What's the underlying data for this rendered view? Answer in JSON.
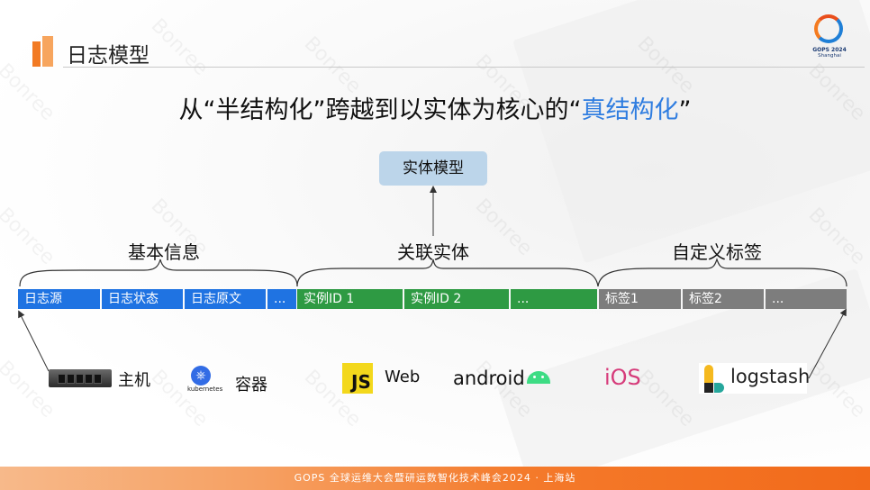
{
  "page_title": "日志模型",
  "logo": {
    "name": "GOPS 2024",
    "city": "Shanghai"
  },
  "headline": {
    "prefix": "从“半结构化”跨越到以实体为核心的“",
    "highlight": "真结构化",
    "suffix": "”"
  },
  "model_box": "实体模型",
  "groups": [
    {
      "label": "基本信息"
    },
    {
      "label": "关联实体"
    },
    {
      "label": "自定义标签"
    }
  ],
  "fields": {
    "basic": [
      "日志源",
      "日志状态",
      "日志原文",
      "..."
    ],
    "entity": [
      "实例ID 1",
      "实例ID 2",
      "..."
    ],
    "tags": [
      "标签1",
      "标签2",
      "..."
    ]
  },
  "sources": {
    "host": "主机",
    "container": "容器",
    "kubernetes": "kubernetes",
    "js_logo": "JS",
    "web": "Web",
    "android": "android",
    "ios": "iOS",
    "logstash": "logstash"
  },
  "colors": {
    "basic": "#1f73e2",
    "entity": "#2e9a43",
    "tags": "#7d7d7d",
    "highlight": "#2f7de0",
    "accent": "#f27a23"
  },
  "watermark": "Bonree",
  "footer": "GOPS 全球运维大会暨研运数智化技术峰会2024 · 上海站"
}
